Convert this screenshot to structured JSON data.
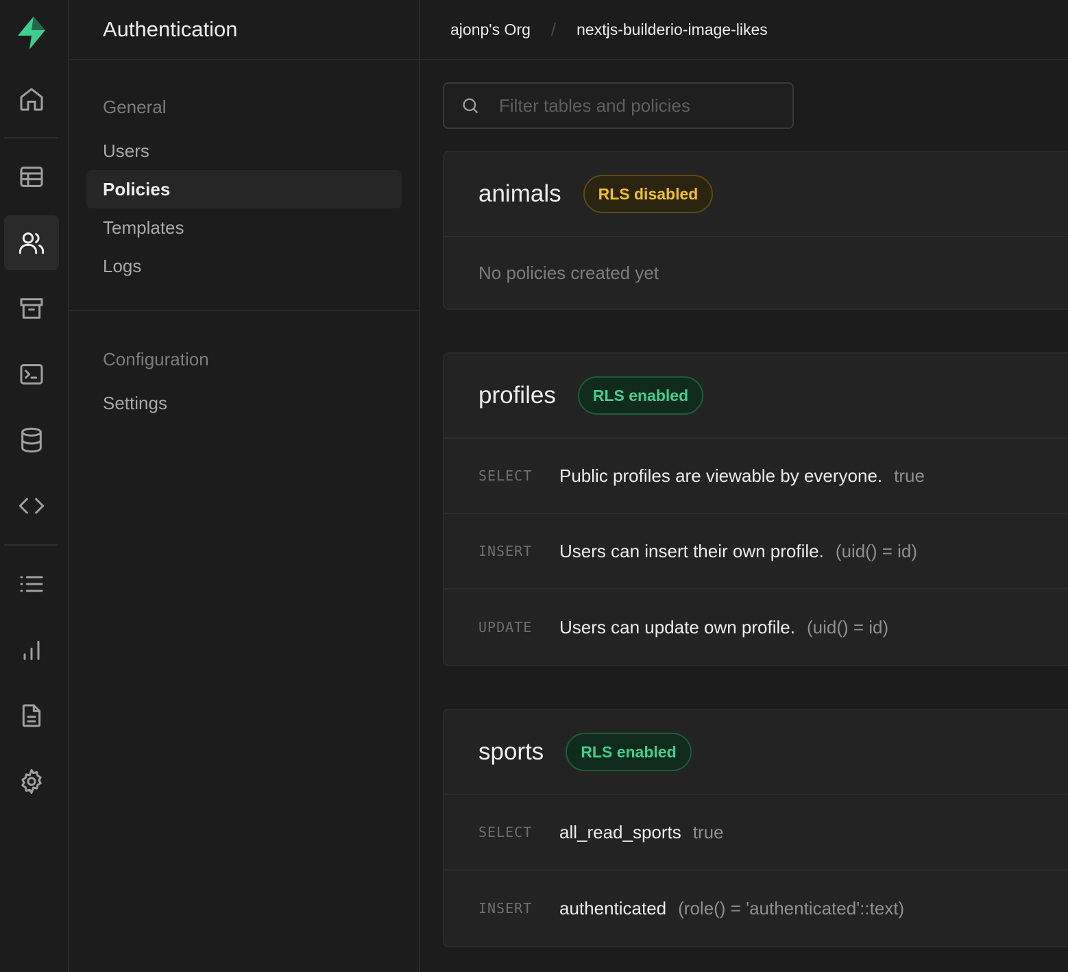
{
  "rail": {
    "logo": "supabase-logo",
    "items": [
      {
        "name": "home-icon"
      },
      {
        "name": "table-editor-icon"
      },
      {
        "name": "authentication-icon",
        "active": true
      },
      {
        "name": "storage-icon"
      },
      {
        "name": "sql-editor-icon"
      },
      {
        "name": "database-icon"
      },
      {
        "name": "api-icon"
      },
      {
        "name": "logs-list-icon"
      },
      {
        "name": "reports-icon"
      },
      {
        "name": "docs-icon"
      },
      {
        "name": "settings-icon"
      }
    ],
    "accent": "#3ecf8e"
  },
  "menu": {
    "title": "Authentication",
    "general_title": "General",
    "general_items": [
      "Users",
      "Policies",
      "Templates",
      "Logs"
    ],
    "active_item": "Policies",
    "config_title": "Configuration",
    "config_items": [
      "Settings"
    ]
  },
  "breadcrumb": {
    "org": "ajonp's Org",
    "separator": "/",
    "project": "nextjs-builderio-image-likes"
  },
  "search": {
    "placeholder": "Filter tables and policies",
    "value": ""
  },
  "tables": [
    {
      "name": "animals",
      "badge": "RLS disabled",
      "status": "disabled",
      "empty_text": "No policies created yet",
      "policies": []
    },
    {
      "name": "profiles",
      "badge": "RLS enabled",
      "status": "enabled",
      "policies": [
        {
          "command": "SELECT",
          "name": "Public profiles are viewable by everyone.",
          "definition": "true"
        },
        {
          "command": "INSERT",
          "name": "Users can insert their own profile.",
          "definition": "(uid() = id)"
        },
        {
          "command": "UPDATE",
          "name": "Users can update own profile.",
          "definition": "(uid() = id)"
        }
      ]
    },
    {
      "name": "sports",
      "badge": "RLS enabled",
      "status": "enabled",
      "policies": [
        {
          "command": "SELECT",
          "name": "all_read_sports",
          "definition": "true"
        },
        {
          "command": "INSERT",
          "name": "authenticated",
          "definition": "(role() = 'authenticated'::text)"
        }
      ]
    }
  ]
}
